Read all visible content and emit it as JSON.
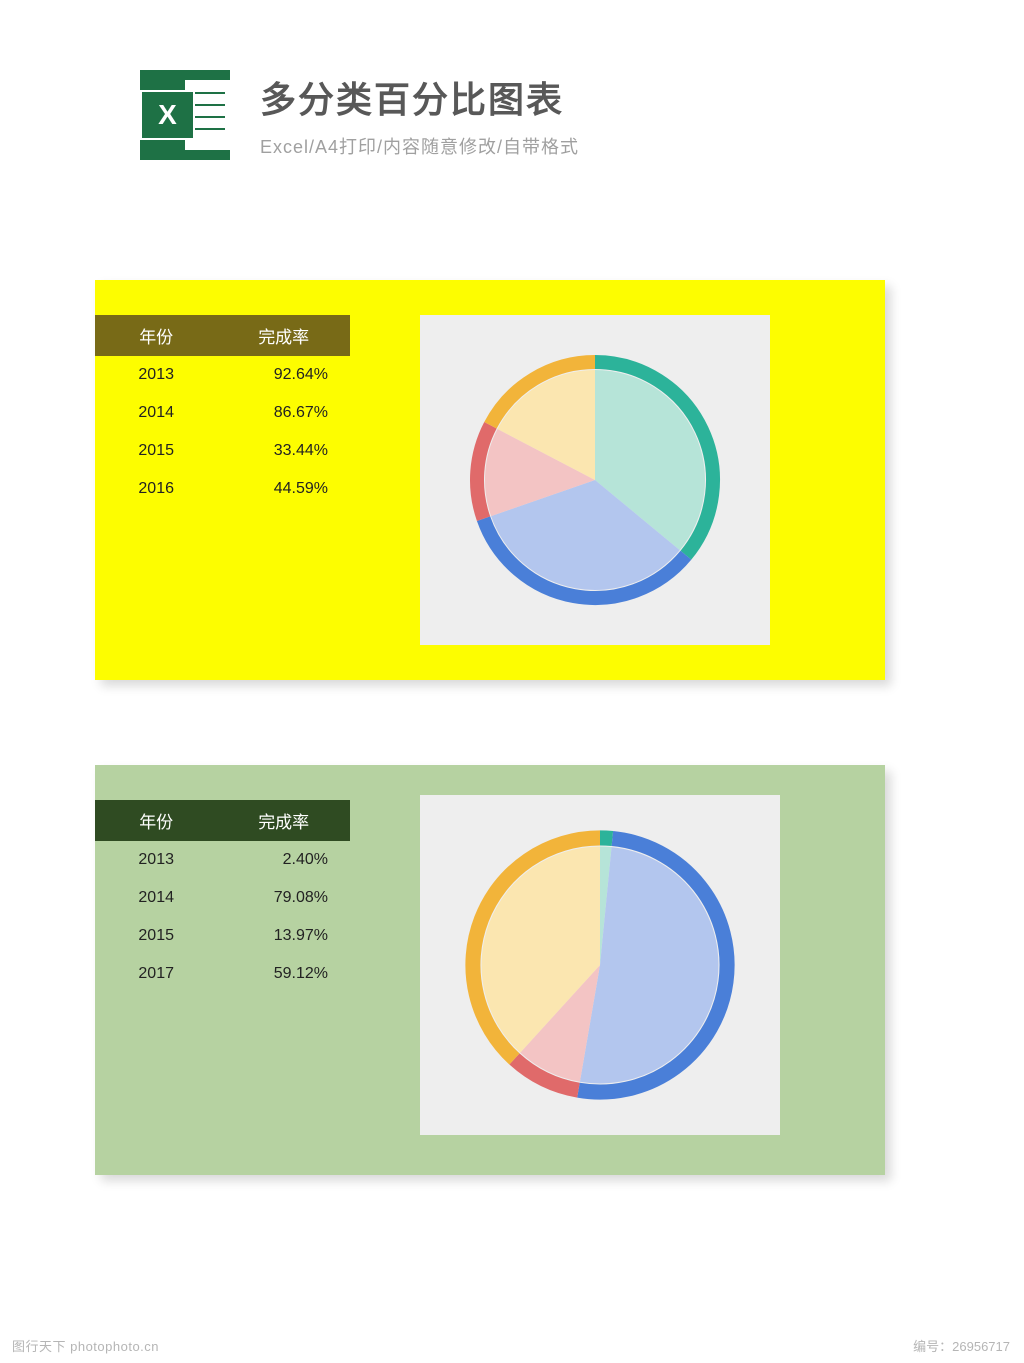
{
  "header": {
    "title": "多分类百分比图表",
    "subtitle": "Excel/A4打印/内容随意修改/自带格式",
    "icon_letter": "X"
  },
  "table_headers": {
    "year": "年份",
    "rate": "完成率"
  },
  "panel_a": {
    "rows": [
      {
        "year": "2013",
        "rate": "92.64%"
      },
      {
        "year": "2014",
        "rate": "86.67%"
      },
      {
        "year": "2015",
        "rate": "33.44%"
      },
      {
        "year": "2016",
        "rate": "44.59%"
      }
    ]
  },
  "panel_b": {
    "rows": [
      {
        "year": "2013",
        "rate": "2.40%"
      },
      {
        "year": "2014",
        "rate": "79.08%"
      },
      {
        "year": "2015",
        "rate": "13.97%"
      },
      {
        "year": "2017",
        "rate": "59.12%"
      }
    ]
  },
  "colors": {
    "teal": "#2cb39a",
    "teal_fill": "#b6e4d8",
    "blue": "#4a7fd8",
    "blue_fill": "#b3c6ee",
    "red": "#e06a6a",
    "red_fill": "#f3c4c4",
    "orange": "#f2b43a",
    "orange_fill": "#fbe6b0",
    "green_ring": "#2cb39a"
  },
  "chart_data": [
    {
      "type": "pie",
      "title": "",
      "note": "Panel A completion percentages mapped to pie share",
      "series": [
        {
          "name": "2013",
          "value": 92.64,
          "ring_color": "#2cb39a",
          "fill_color": "#b6e4d8"
        },
        {
          "name": "2014",
          "value": 86.67,
          "ring_color": "#4a7fd8",
          "fill_color": "#b3c6ee"
        },
        {
          "name": "2015",
          "value": 33.44,
          "ring_color": "#e06a6a",
          "fill_color": "#f3c4c4"
        },
        {
          "name": "2016",
          "value": 44.59,
          "ring_color": "#f2b43a",
          "fill_color": "#fbe6b0"
        }
      ]
    },
    {
      "type": "pie",
      "title": "",
      "note": "Panel B completion percentages mapped to pie share",
      "series": [
        {
          "name": "2013",
          "value": 2.4,
          "ring_color": "#2cb39a",
          "fill_color": "#b6e4d8"
        },
        {
          "name": "2014",
          "value": 79.08,
          "ring_color": "#4a7fd8",
          "fill_color": "#b3c6ee"
        },
        {
          "name": "2015",
          "value": 13.97,
          "ring_color": "#e06a6a",
          "fill_color": "#f3c4c4"
        },
        {
          "name": "2017",
          "value": 59.12,
          "ring_color": "#f2b43a",
          "fill_color": "#fbe6b0"
        }
      ]
    }
  ],
  "watermark": {
    "site": "图行天下 photophoto.cn",
    "serial_label": "编号：",
    "serial": "26956717"
  }
}
